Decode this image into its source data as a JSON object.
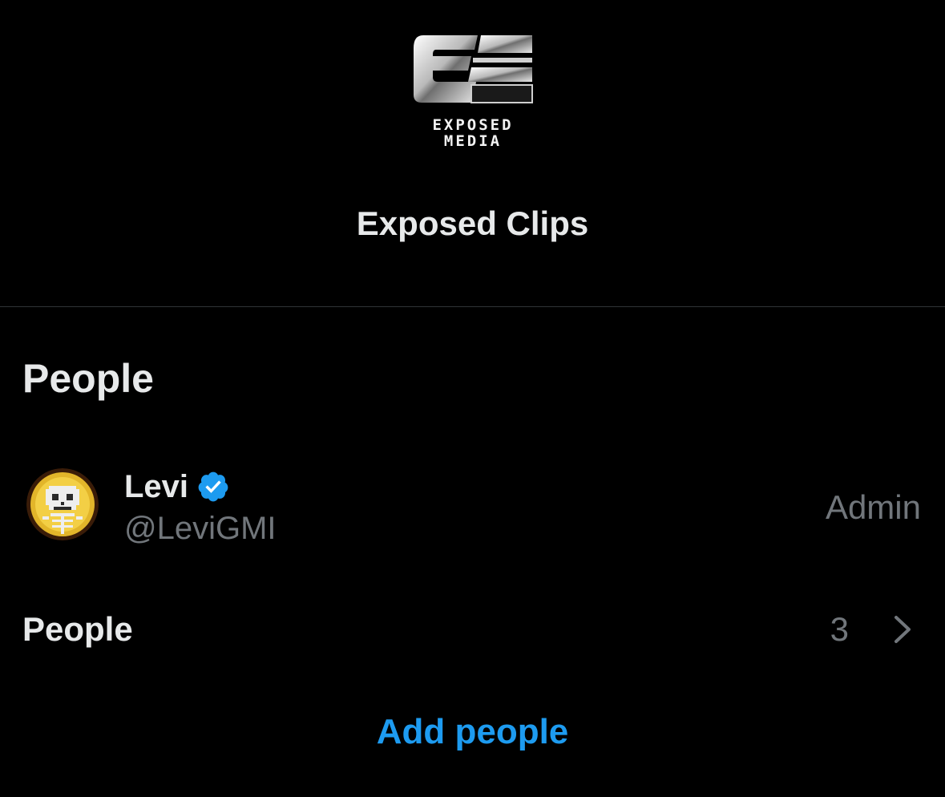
{
  "group": {
    "logo_text_line1": "EXPOSED",
    "logo_text_line2": "MEDIA",
    "title": "Exposed Clips"
  },
  "people_section": {
    "heading": "People",
    "members": [
      {
        "name": "Levi",
        "handle": "@LeviGMI",
        "role": "Admin",
        "verified": true,
        "avatar_icon": "skeleton-avatar-icon"
      }
    ],
    "people_row": {
      "label": "People",
      "count": "3"
    },
    "add_label": "Add people"
  },
  "colors": {
    "background": "#000000",
    "primary_text": "#e7e9ea",
    "secondary_text": "#71767b",
    "accent": "#1d9bf0",
    "divider": "#2f3336"
  }
}
